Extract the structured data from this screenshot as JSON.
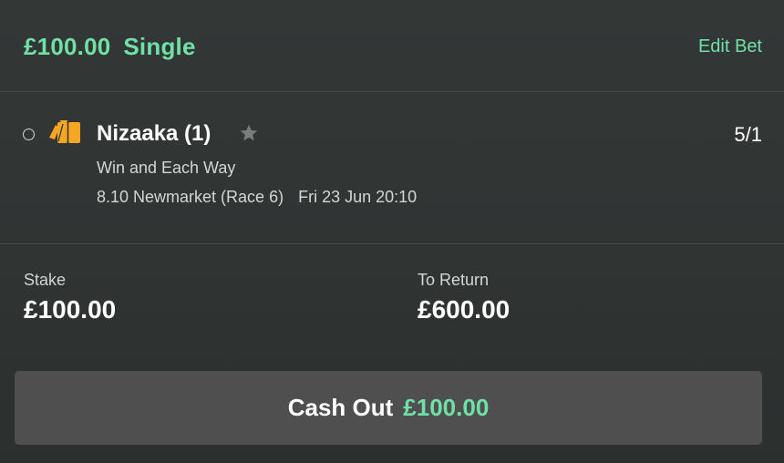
{
  "bet": {
    "amount": "£100.00",
    "type": "Single",
    "edit_label": "Edit Bet"
  },
  "selection": {
    "runner": "Nizaaka (1)",
    "odds": "5/1",
    "market": "Win and Each Way",
    "race": "8.10 Newmarket (Race 6)",
    "datetime": "Fri 23 Jun 20:10",
    "silks_icon": "jockey-silks-icon",
    "favourite_icon": "star-icon"
  },
  "stake": {
    "label": "Stake",
    "value": "£100.00"
  },
  "return": {
    "label": "To Return",
    "value": "£600.00"
  },
  "cashout": {
    "label": "Cash Out",
    "amount": "£100.00"
  },
  "colors": {
    "accent": "#6fe0a6",
    "background": "#303433",
    "button": "#4f4f4f",
    "silks": "#f5a623"
  }
}
